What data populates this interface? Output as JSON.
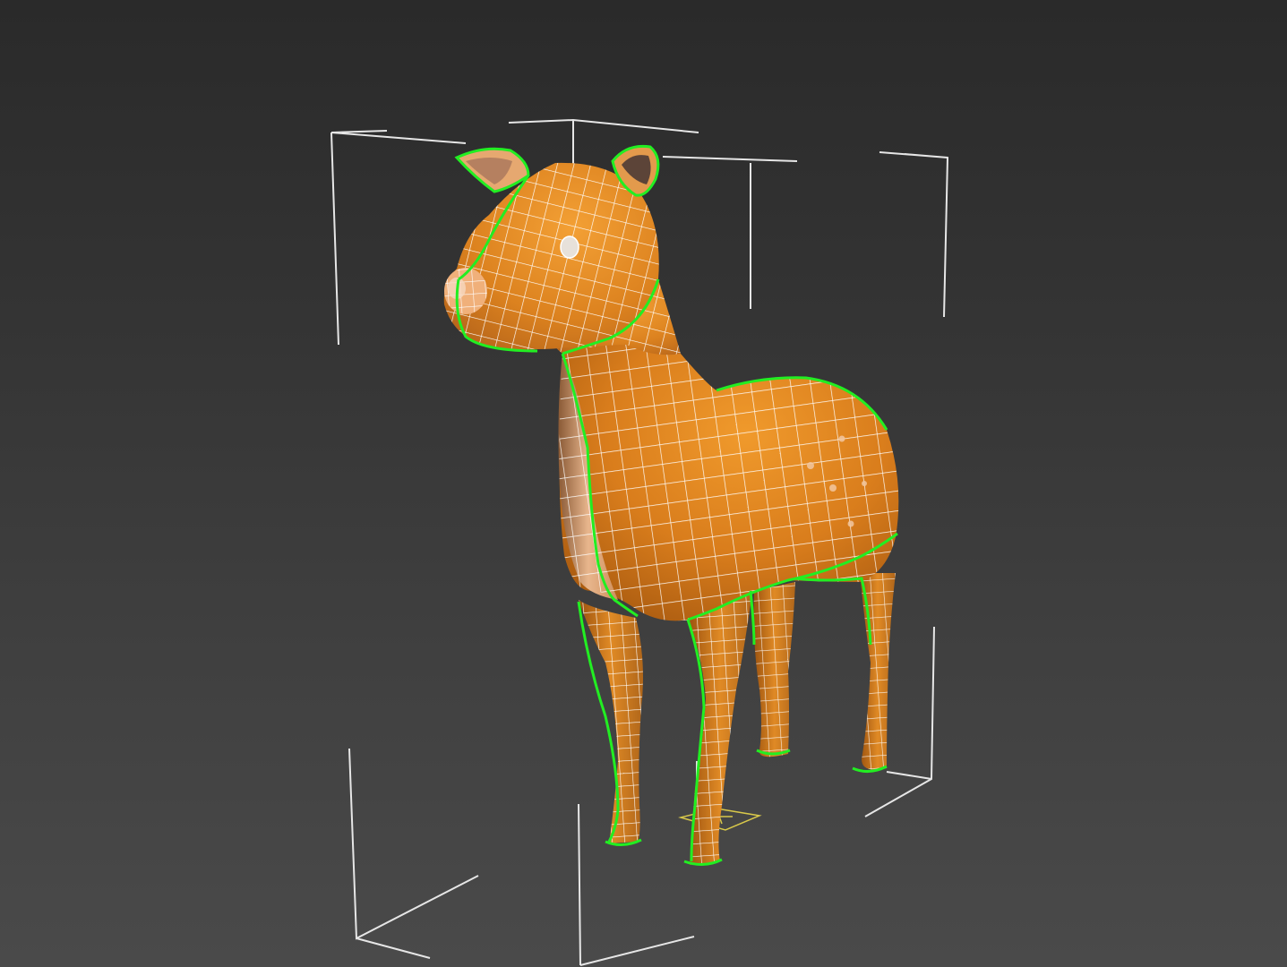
{
  "viewport": {
    "background_top": "#2a2a2a",
    "background_bottom": "#4a4a4a"
  },
  "model": {
    "subject": "deer",
    "body_color": "#d9801f",
    "belly_color": "#e6b48a",
    "wire_color": "#ffffff",
    "seam_color": "#22ee22",
    "selection_box_color": "#e8e8e8",
    "pivot_gizmo_color": "#e0d040"
  }
}
